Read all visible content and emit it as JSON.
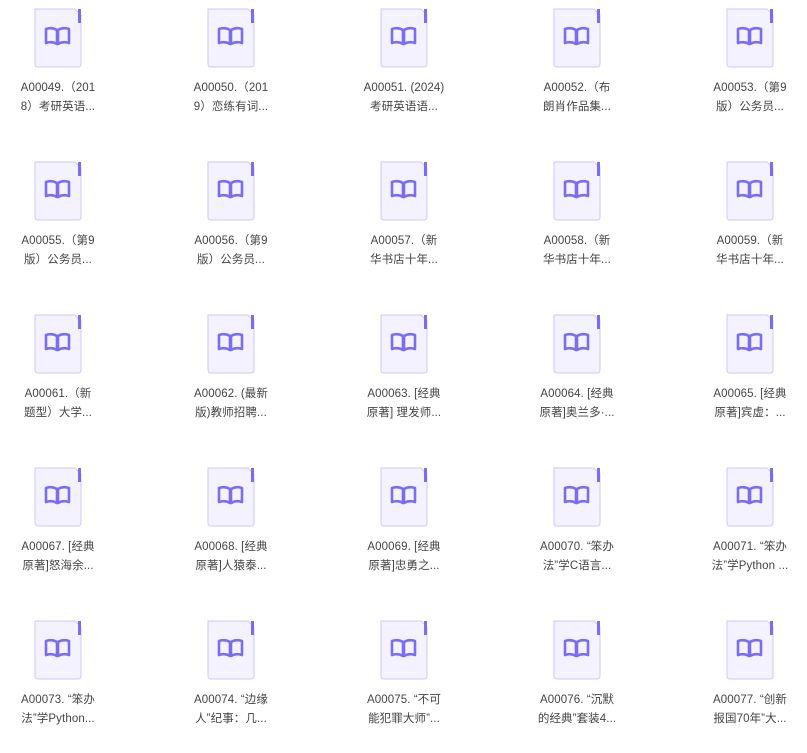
{
  "colors": {
    "icon_bg": "#f3f2fe",
    "icon_border": "#cfcaf5",
    "icon_accent": "#7a6df0",
    "text": "#444444"
  },
  "icon": "book-file-icon",
  "files": [
    {
      "line1": "A00049.（201",
      "line2": "8）考研英语..."
    },
    {
      "line1": "A00050.（201",
      "line2": "9）恋练有词..."
    },
    {
      "line1": "A00051. (2024)",
      "line2": "考研英语语..."
    },
    {
      "line1": "A00052.（布",
      "line2": "朗肖作品集..."
    },
    {
      "line1": "A00053.（第9",
      "line2": "版）公务员..."
    },
    {
      "line1": "A00055.（第9",
      "line2": "版）公务员..."
    },
    {
      "line1": "A00056.（第9",
      "line2": "版）公务员..."
    },
    {
      "line1": "A00057.（新",
      "line2": "华书店十年..."
    },
    {
      "line1": "A00058.（新",
      "line2": "华书店十年..."
    },
    {
      "line1": "A00059.（新",
      "line2": "华书店十年..."
    },
    {
      "line1": "A00061.（新",
      "line2": "题型）大学..."
    },
    {
      "line1": "A00062. (最新",
      "line2": "版)教师招聘..."
    },
    {
      "line1": "A00063. [经典",
      "line2": "原著] 理发师..."
    },
    {
      "line1": "A00064. [经典",
      "line2": "原著]奥兰多·..."
    },
    {
      "line1": "A00065. [经典",
      "line2": "原著]宾虚：..."
    },
    {
      "line1": "A00067. [经典",
      "line2": "原著]怒海余..."
    },
    {
      "line1": "A00068. [经典",
      "line2": "原著]人猿泰..."
    },
    {
      "line1": "A00069. [经典",
      "line2": "原著]忠勇之..."
    },
    {
      "line1": "A00070. “笨办",
      "line2": "法”学C语言..."
    },
    {
      "line1": "A00071. “笨办",
      "line2": "法”学Python ..."
    },
    {
      "line1": "A00073. “笨办",
      "line2": "法”学Python..."
    },
    {
      "line1": "A00074. “边缘",
      "line2": "人”纪事：几..."
    },
    {
      "line1": "A00075. “不可",
      "line2": "能犯罪大师”..."
    },
    {
      "line1": "A00076. “沉默",
      "line2": "的经典”套装4..."
    },
    {
      "line1": "A00077. “创新",
      "line2": "报国70年”大..."
    }
  ]
}
